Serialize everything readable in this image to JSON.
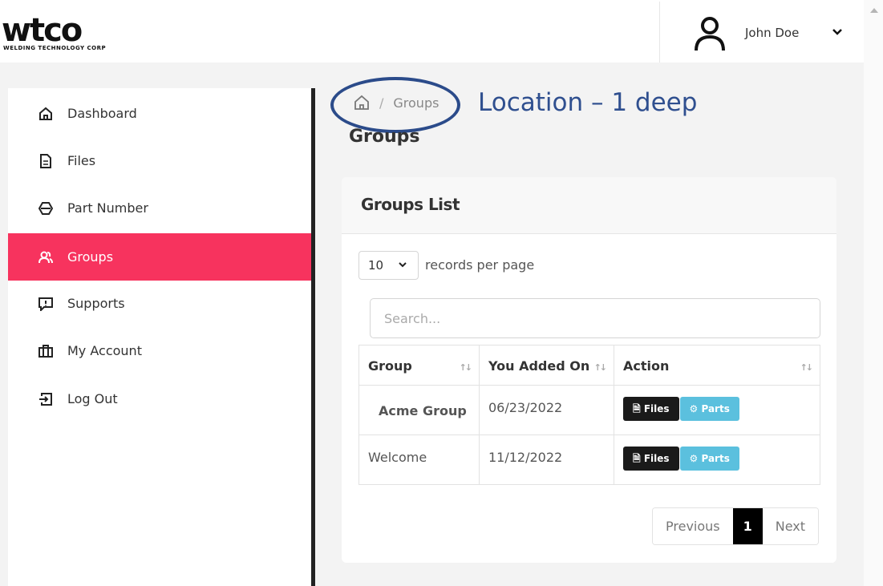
{
  "header": {
    "logo_text": "wtco",
    "logo_subtitle": "WELDING TECHNOLOGY CORP",
    "user_name": "John Doe"
  },
  "sidebar": {
    "items": [
      {
        "label": "Dashboard",
        "icon": "home-icon",
        "active": false
      },
      {
        "label": "Files",
        "icon": "file-icon",
        "active": false
      },
      {
        "label": "Part Number",
        "icon": "part-number-icon",
        "active": false
      },
      {
        "label": "Groups",
        "icon": "users-icon",
        "active": true
      },
      {
        "label": "Supports",
        "icon": "support-icon",
        "active": false
      },
      {
        "label": "My Account",
        "icon": "briefcase-icon",
        "active": false
      },
      {
        "label": "Log Out",
        "icon": "logout-icon",
        "active": false
      }
    ]
  },
  "breadcrumb": {
    "current": "Groups",
    "separator": "/"
  },
  "annotation": "Location – 1 deep",
  "page_title": "Groups",
  "card": {
    "title": "Groups List",
    "page_length": "10",
    "page_length_label": "records per page",
    "search_placeholder": "Search...",
    "columns": [
      "Group",
      "You Added On",
      "Action"
    ],
    "rows": [
      {
        "group": "Acme Group",
        "added_on": "06/23/2022",
        "files_label": "Files",
        "parts_label": "Parts"
      },
      {
        "group": "Welcome",
        "added_on": "11/12/2022",
        "files_label": "Files",
        "parts_label": "Parts"
      }
    ],
    "pagination": {
      "previous": "Previous",
      "current": "1",
      "next": "Next"
    }
  },
  "colors": {
    "accent": "#f7335e",
    "annotation": "#2f4f8f",
    "parts_button": "#5bc0de",
    "files_button": "#1a1a1a"
  }
}
